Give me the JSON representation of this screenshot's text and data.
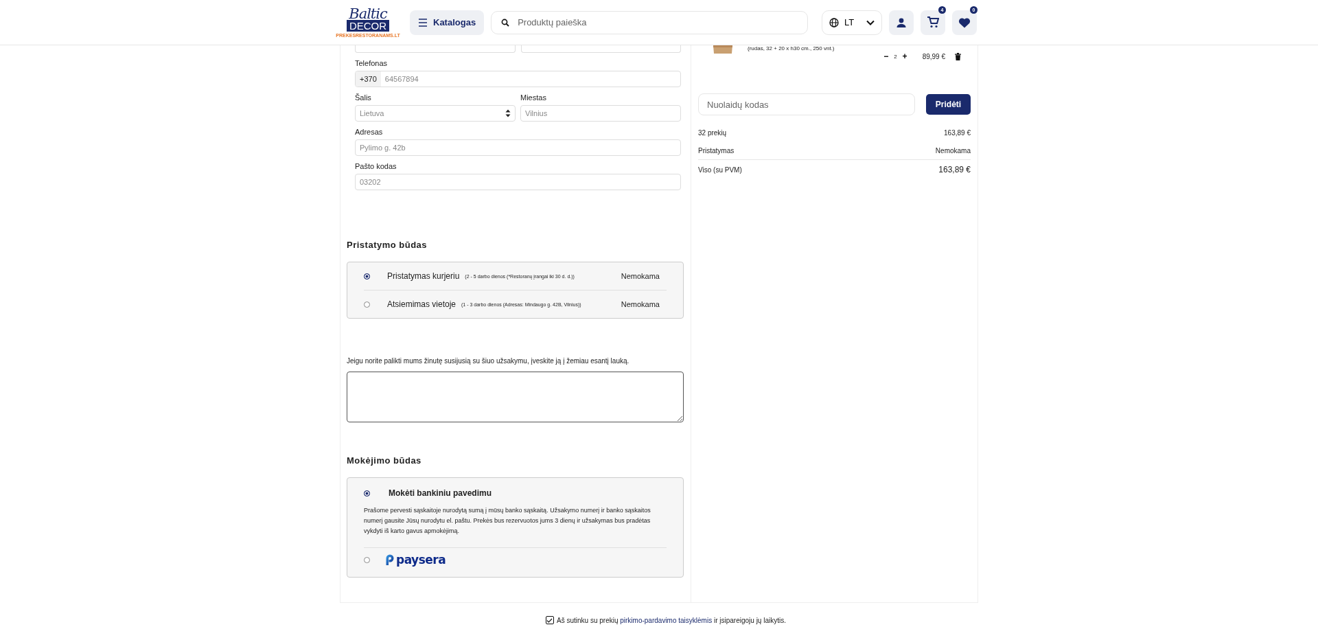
{
  "header": {
    "logo": {
      "script": "Baltic",
      "block": "DECOR",
      "tagline": "PREKESRESTORANAMS.LT"
    },
    "catalog_button": "Katalogas",
    "search": {
      "placeholder": "Produktų paieška"
    },
    "language": "LT",
    "cart_count": "4",
    "wishlist_count": "0"
  },
  "contact_form": {
    "rows": [
      [
        {
          "label": "Telefonas",
          "kind": "phone",
          "prefix": "+370",
          "placeholder": "64567894"
        }
      ],
      [
        {
          "label": "Šalis",
          "kind": "select",
          "placeholder": "Lietuva"
        },
        {
          "label": "Miestas",
          "kind": "text",
          "placeholder": "Vilnius"
        }
      ],
      [
        {
          "label": "Adresas",
          "kind": "text",
          "placeholder": "Pylimo g. 42b"
        }
      ],
      [
        {
          "label": "Pašto kodas",
          "kind": "text",
          "placeholder": "03202"
        }
      ]
    ]
  },
  "delivery": {
    "title": "Pristatymo būdas",
    "options": [
      {
        "name": "Pristatymas kurjeriu",
        "note": "(2 - 5 darbo dienos (*Restoranų įrangai iki 30 d. d.))",
        "price": "Nemokama",
        "selected": true
      },
      {
        "name": "Atsiemimas vietoje",
        "note": "(1 - 3 darbo dienos (Adresas: Mindaugo g. 42B, Vilnius))",
        "price": "Nemokama",
        "selected": false
      }
    ]
  },
  "message": {
    "prompt": "Jeigu norite palikti mums žinutę susijusią su šiuo užsakymu, įveskite ją į žemiau esantį lauką."
  },
  "payment": {
    "title": "Mokėjimo būdas",
    "options": [
      {
        "kind": "text",
        "name": "Mokėti bankiniu pavedimu",
        "description": "Prašome pervesti sąskaitoje nurodytą sumą į mūsų banko sąskaitą. Užsakymo numerį ir banko sąskaitos numerį gausite Jūsų nurodytu el. paštu. Prekės bus rezervuotos jums 3 dienų ir užsakymas bus pradėtas vykdyti iš karto gavus apmokėjimą.",
        "selected": true
      },
      {
        "kind": "logo",
        "name": "paysera",
        "selected": false
      }
    ]
  },
  "cart": {
    "item": {
      "variant": "(rudas, 32 + 20 x h30 cm., 250 vnt.)",
      "decrease": "−",
      "quantity": "2",
      "increase": "+",
      "price": "89,99 €"
    },
    "discount": {
      "placeholder": "Nuolaidų kodas",
      "button": "Pridėti"
    },
    "summary": [
      {
        "label": "32 prekių",
        "value": "163,89 €"
      },
      {
        "label": "Pristatymas",
        "value": "Nemokama"
      }
    ],
    "total": {
      "label": "Viso (su PVM)",
      "value": "163,89 €"
    }
  },
  "agreement": {
    "checked": true,
    "before": "Aš sutinku su prekių",
    "link": "pirkimo-pardavimo taisyklėmis",
    "after": "ir įsipareigoju jų laikytis."
  }
}
